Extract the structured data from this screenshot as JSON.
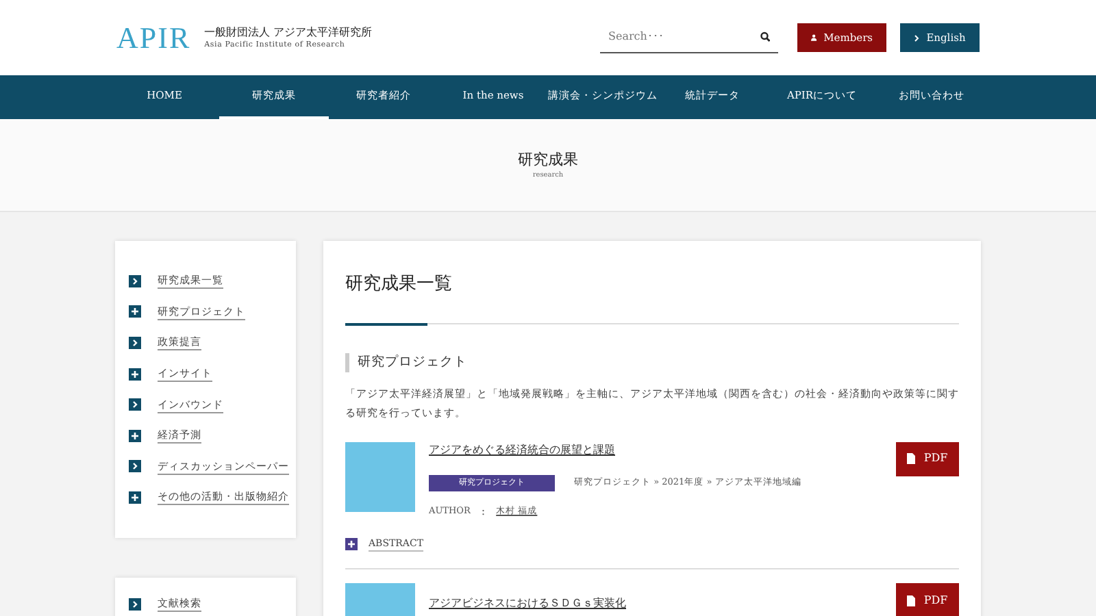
{
  "logo": {
    "mark": "APIR",
    "org_ja": "一般財団法人 アジア太平洋研究所",
    "org_en": "Asia Pacific Institute of Research"
  },
  "search": {
    "placeholder": "Search･･･"
  },
  "header_buttons": [
    {
      "label": "Members",
      "kind": "members"
    },
    {
      "label": "English",
      "kind": "english"
    }
  ],
  "nav": [
    {
      "label": "HOME",
      "selected": false
    },
    {
      "label": "研究成果",
      "selected": true
    },
    {
      "label": "研究者紹介",
      "selected": false
    },
    {
      "label": "In the news",
      "selected": false
    },
    {
      "label": "講演会・シンポジウム",
      "selected": false
    },
    {
      "label": "統計データ",
      "selected": false
    },
    {
      "label": "APIRについて",
      "selected": false
    },
    {
      "label": "お問い合わせ",
      "selected": false
    }
  ],
  "page_title": {
    "title": "研究成果",
    "subtitle": "research"
  },
  "sidebar": {
    "items": [
      {
        "label": "研究成果一覧",
        "kind": "arrow"
      },
      {
        "label": "研究プロジェクト",
        "kind": "plus"
      },
      {
        "label": "政策提言",
        "kind": "arrow"
      },
      {
        "label": "インサイト",
        "kind": "plus"
      },
      {
        "label": "インバウンド",
        "kind": "arrow"
      },
      {
        "label": "経済予測",
        "kind": "plus"
      },
      {
        "label": "ディスカッションペーパー",
        "kind": "arrow"
      },
      {
        "label": "その他の活動・出版物紹介",
        "kind": "plus"
      }
    ],
    "second_items": [
      {
        "label": "文献検索",
        "kind": "arrow"
      }
    ]
  },
  "main": {
    "heading": "研究成果一覧",
    "section": "研究プロジェクト",
    "description": "「アジア太平洋経済展望」と「地域発展戦略」を主軸に、アジア太平洋地域（関西を含む）の社会・経済動向や政策等に関する研究を行っています。",
    "entries": [
      {
        "title": "アジアをめぐる経済統合の展望と課題",
        "tag": "研究プロジェクト",
        "breadcrumb": "研究プロジェクト » 2021年度 » アジア太平洋地域編",
        "author_label": "AUTHOR",
        "author_sep": ":",
        "author": "木村 福成",
        "abstract": "ABSTRACT",
        "pdf": "PDF"
      },
      {
        "title": "アジアビジネスにおけるＳＤＧｓ実装化",
        "pdf": "PDF"
      }
    ]
  }
}
